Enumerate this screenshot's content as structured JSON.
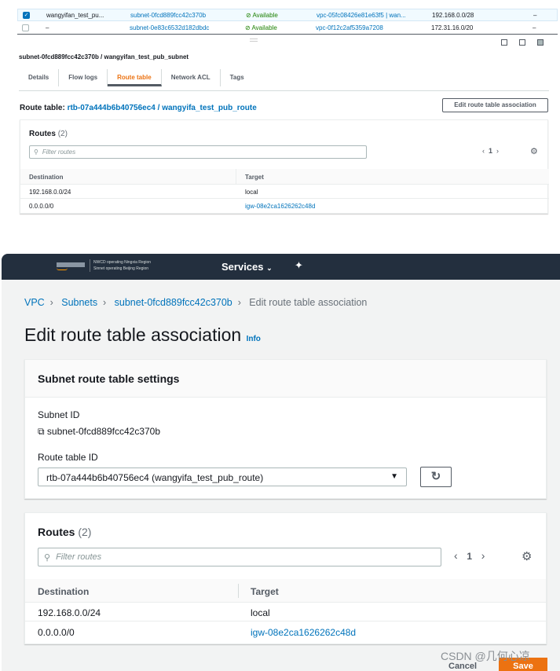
{
  "subnet_list": [
    {
      "checked": true,
      "name": "wangyifan_test_pu...",
      "subnet_id": "subnet-0fcd889fcc42c370b",
      "state": "Available",
      "vpc": "vpc-05fc08426e81e63f5 | wan...",
      "cidr": "192.168.0.0/28",
      "extra": "–"
    },
    {
      "checked": false,
      "name": "–",
      "subnet_id": "subnet-0e83c6532d182dbdc",
      "state": "Available",
      "vpc": "vpc-0f12c2af5359a7208",
      "cidr": "172.31.16.0/20",
      "extra": "–"
    }
  ],
  "detail": {
    "title": "subnet-0fcd889fcc42c370b / wangyifan_test_pub_subnet",
    "tabs": [
      "Details",
      "Flow logs",
      "Route table",
      "Network ACL",
      "Tags"
    ],
    "active_tab": "Route table",
    "route_table_label": "Route table:",
    "route_table_link": "rtb-07a444b6b40756ec4 / wangyifa_test_pub_route",
    "edit_button": "Edit route table association",
    "routes_title": "Routes",
    "routes_count": "(2)",
    "filter_placeholder": "Filter routes",
    "page": "1",
    "columns": [
      "Destination",
      "Target"
    ],
    "routes": [
      {
        "destination": "192.168.0.0/24",
        "target": "local"
      },
      {
        "destination": "0.0.0.0/0",
        "target": "igw-08e2ca1626262c48d"
      }
    ]
  },
  "header": {
    "logo_line1": "NWCD operating Ningxia Region",
    "logo_line2": "Sinnet operating Beijing Region",
    "services": "Services"
  },
  "breadcrumb": [
    "VPC",
    "Subnets",
    "subnet-0fcd889fcc42c370b",
    "Edit route table association"
  ],
  "page_title": "Edit route table association",
  "info": "Info",
  "settings": {
    "title": "Subnet route table settings",
    "subnet_id_label": "Subnet ID",
    "subnet_id": "subnet-0fcd889fcc42c370b",
    "route_table_label": "Route table ID",
    "route_table_value": "rtb-07a444b6b40756ec4 (wangyifa_test_pub_route)"
  },
  "routes": {
    "title": "Routes",
    "count": "(2)",
    "filter_placeholder": "Filter routes",
    "page": "1",
    "columns": [
      "Destination",
      "Target"
    ],
    "rows": [
      {
        "destination": "192.168.0.0/24",
        "target": "local"
      },
      {
        "destination": "0.0.0.0/0",
        "target": "igw-08e2ca1626262c48d"
      }
    ]
  },
  "footer": {
    "cancel": "Cancel",
    "save": "Save"
  },
  "watermark": "CSDN @几何心凉",
  "colors": {
    "link": "#0073bb",
    "accent": "#ec7211",
    "header_bg": "#232f3e",
    "available": "#1d8102"
  }
}
